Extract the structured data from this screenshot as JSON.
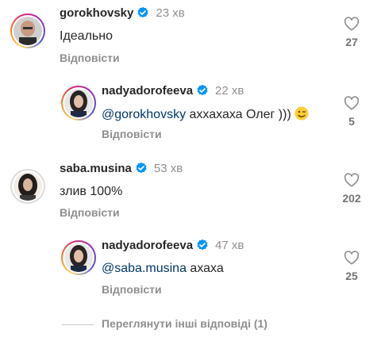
{
  "reply_label": "Відповісти",
  "view_more": "Переглянути інші відповіді (1)",
  "comments": [
    {
      "username": "gorokhovsky",
      "time": "23 хв",
      "text": "Ідеально",
      "likes": "27"
    },
    {
      "username": "nadyadorofeeva",
      "time": "22 хв",
      "mention": "@gorokhovsky",
      "text": "аххахаха Олег )))",
      "emoji": "wink-emoji",
      "likes": "5"
    },
    {
      "username": "saba.musina",
      "time": "53 хв",
      "text": "злив 100%",
      "likes": "202"
    },
    {
      "username": "nadyadorofeeva",
      "time": "47 хв",
      "mention": "@saba.musina",
      "text": "ахаха",
      "likes": "25"
    }
  ],
  "colors": {
    "verified": "#0095f6",
    "mention": "#00376b",
    "secondary_text": "#8e8e8e"
  }
}
